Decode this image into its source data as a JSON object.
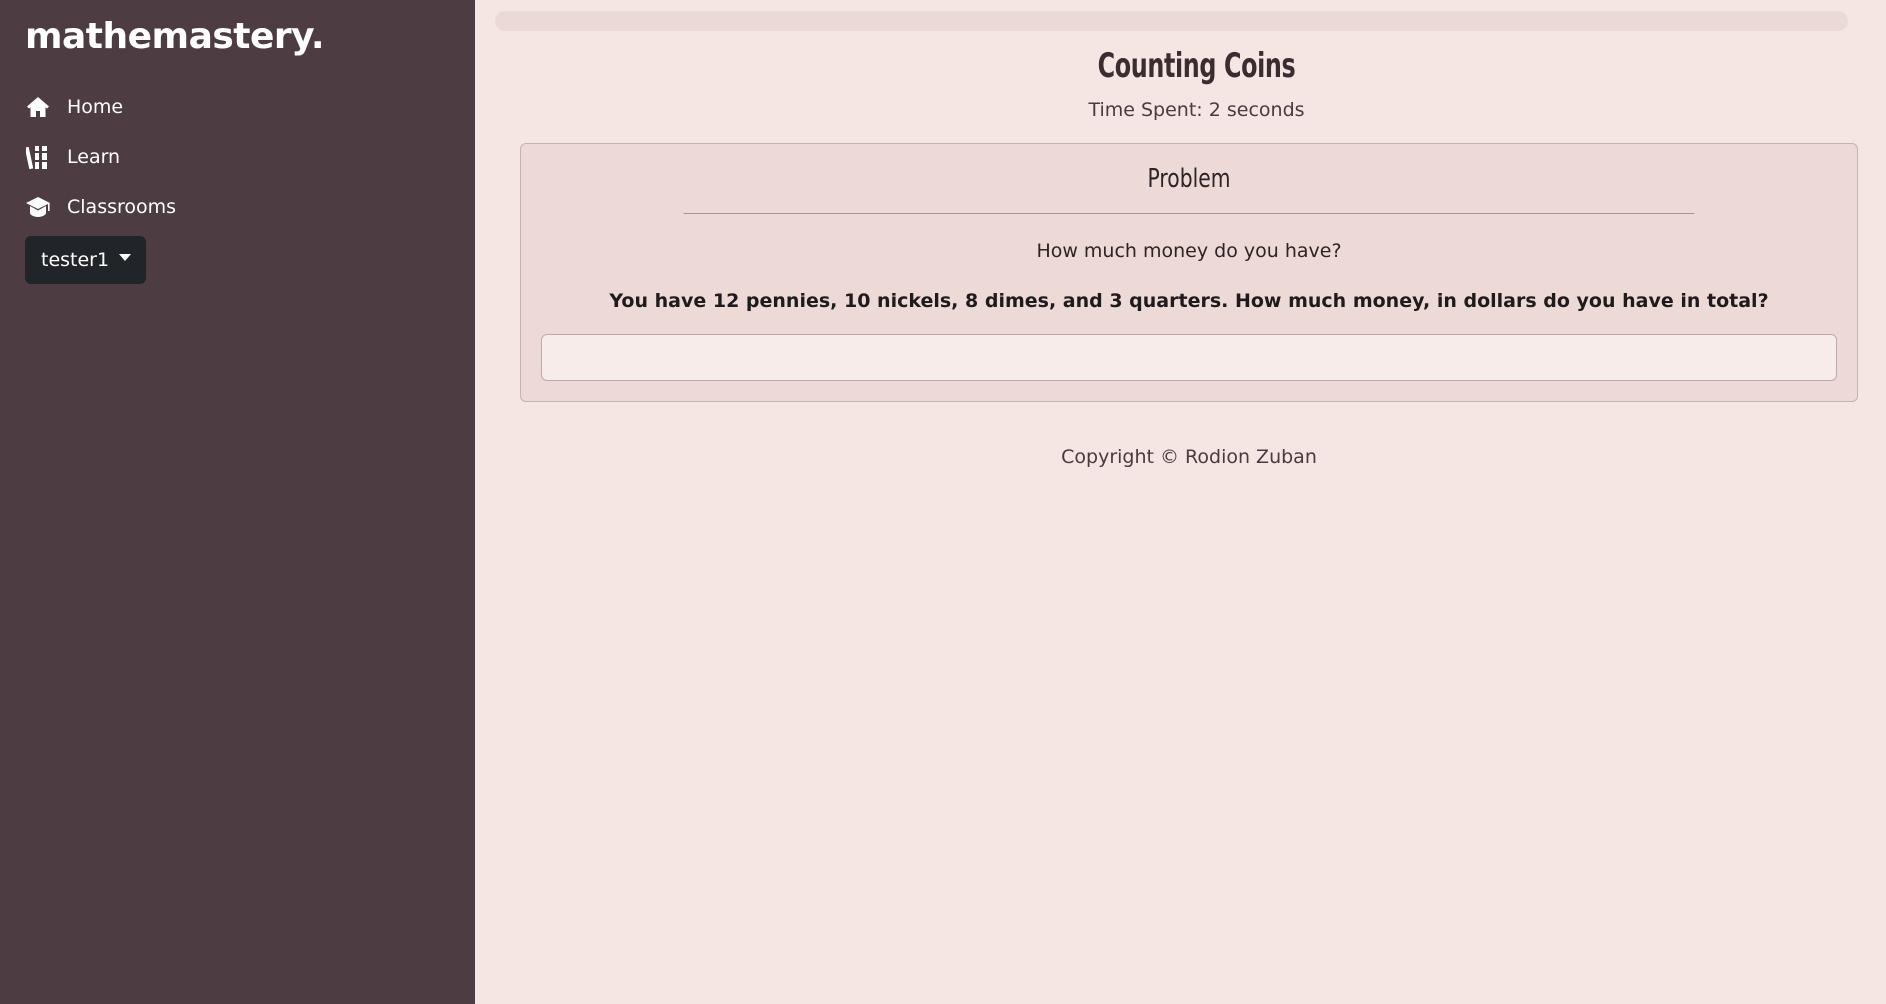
{
  "sidebar": {
    "brand": "mathemastery.",
    "items": [
      {
        "label": "Home",
        "icon": "home-icon"
      },
      {
        "label": "Learn",
        "icon": "books-icon"
      },
      {
        "label": "Classrooms",
        "icon": "graduation-cap-icon"
      }
    ],
    "user_button": "tester1"
  },
  "main": {
    "progress_fraction": 0,
    "title": "Counting Coins",
    "time_spent": "Time Spent: 2 seconds",
    "card": {
      "header": "Problem",
      "question": "How much money do you have?",
      "problem": "You have 12 pennies, 10 nickels, 8 dimes, and 3 quarters. How much money, in dollars do you have in total?",
      "answer_value": ""
    },
    "footer": "Copyright © Rodion Zuban"
  },
  "colors": {
    "sidebar_bg": "#4d3c42",
    "page_bg": "#f5e6e3",
    "card_bg": "#edd9d5",
    "user_button_bg": "#212529"
  }
}
